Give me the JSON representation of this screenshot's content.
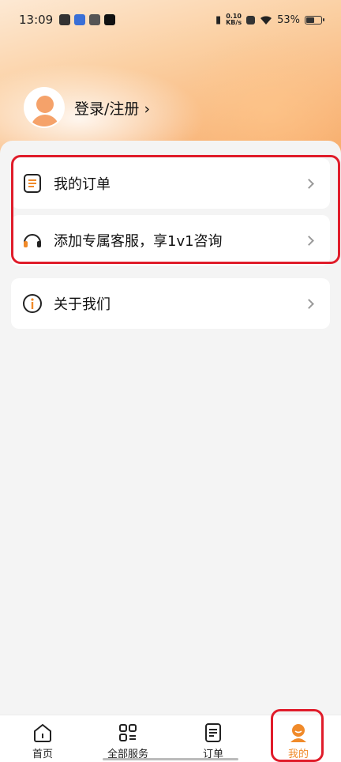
{
  "status_bar": {
    "time": "13:09",
    "net_speed": "0.10",
    "net_unit": "KB/s",
    "battery": "53%"
  },
  "profile": {
    "login_label": "登录/注册 ›"
  },
  "menu": [
    {
      "label": "我的订单",
      "icon": "order-doc-icon"
    },
    {
      "label": "添加专属客服，享1v1咨询",
      "icon": "headset-icon"
    },
    {
      "label": "关于我们",
      "icon": "info-icon"
    }
  ],
  "tabs": [
    {
      "label": "首页",
      "icon": "home-icon"
    },
    {
      "label": "全部服务",
      "icon": "grid-icon"
    },
    {
      "label": "订单",
      "icon": "order-doc-icon"
    },
    {
      "label": "我的",
      "icon": "user-icon"
    }
  ],
  "colors": {
    "accent": "#f08a2a",
    "highlight": "#e01c2a",
    "background": "#f4f4f4"
  }
}
